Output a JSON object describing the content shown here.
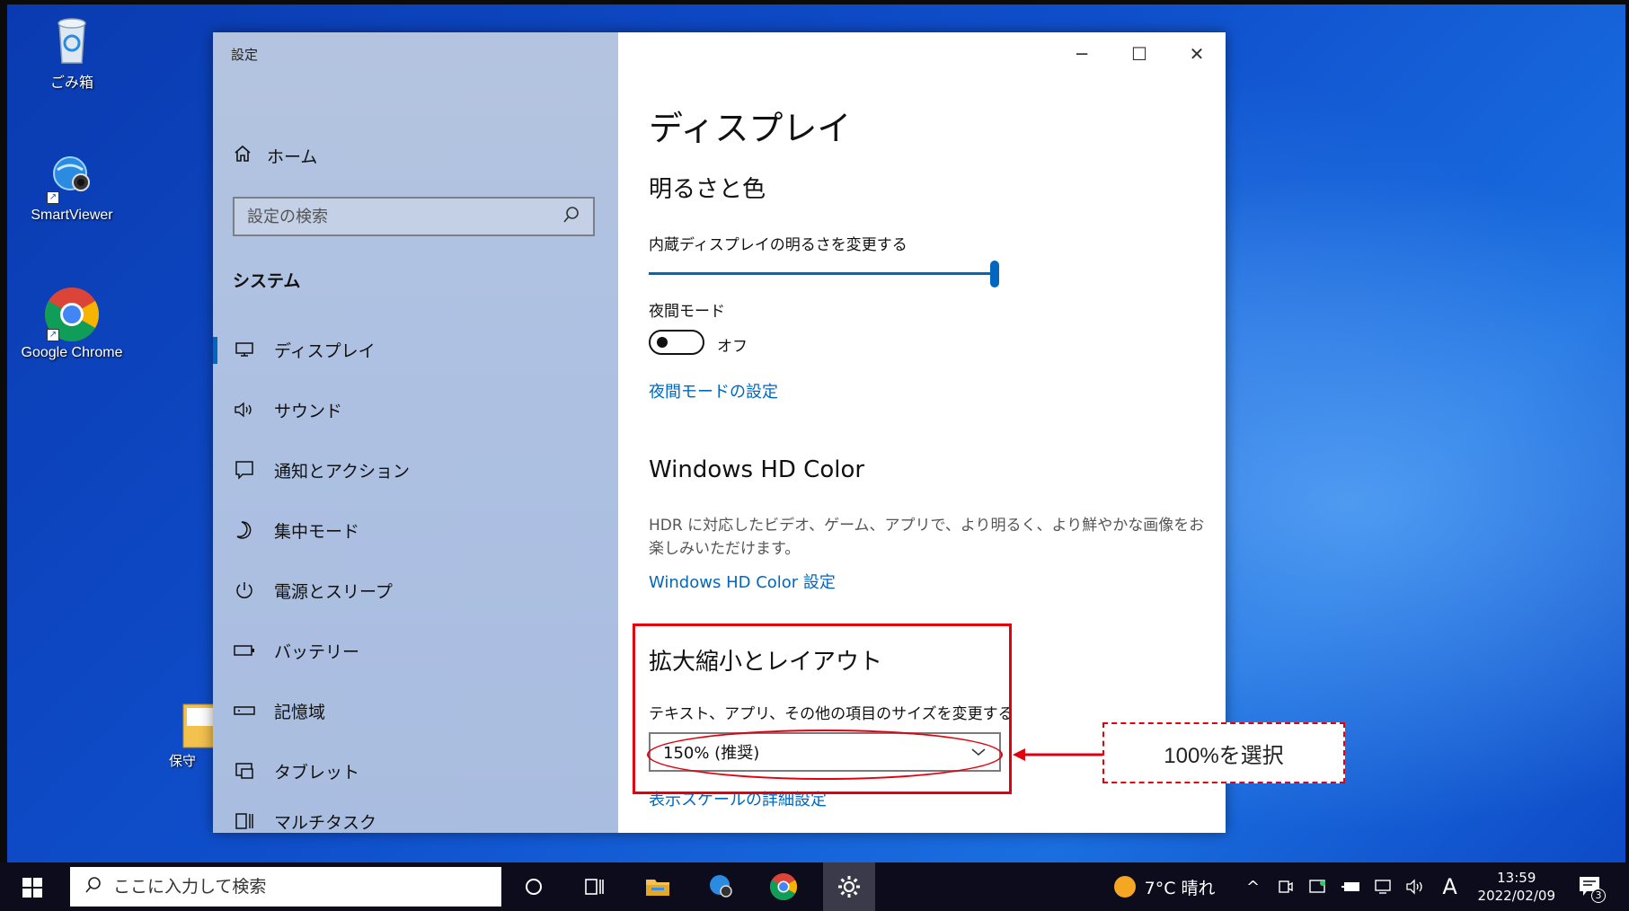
{
  "desktop": {
    "icons": [
      {
        "label": "ごみ箱"
      },
      {
        "label": "SmartViewer"
      },
      {
        "label": "Google Chrome"
      },
      {
        "label": "保守"
      }
    ]
  },
  "window": {
    "title": "設定",
    "controls": {
      "minimize": "─",
      "maximize": "☐",
      "close": "✕"
    }
  },
  "nav": {
    "home_label": "ホーム",
    "search_placeholder": "設定の検索",
    "section_title": "システム",
    "items": [
      {
        "label": "ディスプレイ",
        "icon": "monitor-icon",
        "active": true
      },
      {
        "label": "サウンド",
        "icon": "speaker-icon"
      },
      {
        "label": "通知とアクション",
        "icon": "notification-icon"
      },
      {
        "label": "集中モード",
        "icon": "moon-icon"
      },
      {
        "label": "電源とスリープ",
        "icon": "power-icon"
      },
      {
        "label": "バッテリー",
        "icon": "battery-icon"
      },
      {
        "label": "記憶域",
        "icon": "storage-icon"
      },
      {
        "label": "タブレット",
        "icon": "tablet-icon"
      },
      {
        "label": "マルチタスク",
        "icon": "multitask-icon"
      }
    ]
  },
  "content": {
    "page_title": "ディスプレイ",
    "brightness": {
      "heading": "明るさと色",
      "slider_label": "内蔵ディスプレイの明るさを変更する",
      "slider_value": 1.0,
      "night_mode_label": "夜間モード",
      "night_mode_state": "オフ",
      "night_mode_link": "夜間モードの設定"
    },
    "hdr": {
      "heading": "Windows HD Color",
      "description": "HDR に対応したビデオ、ゲーム、アプリで、より明るく、より鮮やかな画像をお楽しみいただけます。",
      "link": "Windows HD Color 設定"
    },
    "scale": {
      "heading": "拡大縮小とレイアウト",
      "label": "テキスト、アプリ、その他の項目のサイズを変更する",
      "selected": "150% (推奨)",
      "advanced_link": "表示スケールの詳細設定"
    }
  },
  "annotation": {
    "callout_text": "100%を選択",
    "color": "#e0000f"
  },
  "taskbar": {
    "search_placeholder": "ここに入力して検索",
    "weather": "7°C 晴れ",
    "ime": "A",
    "time": "13:59",
    "date": "2022/02/09",
    "notification_count": "3"
  },
  "colors": {
    "accent": "#0067c0",
    "taskbar": "#0c0c1c"
  }
}
